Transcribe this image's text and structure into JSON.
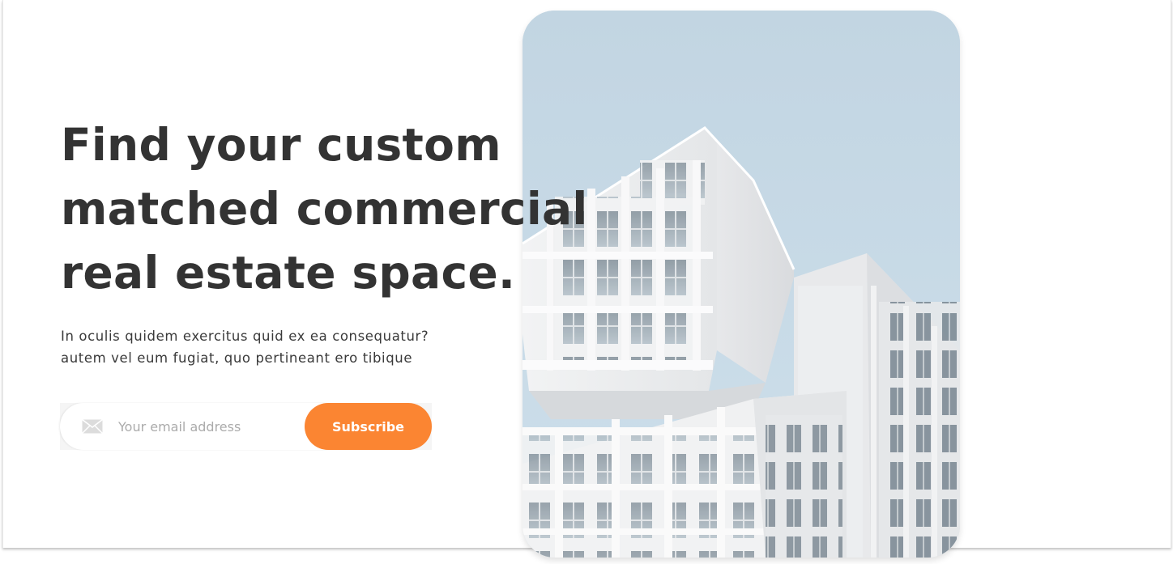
{
  "hero": {
    "headline_lines": [
      "Find your custom",
      "matched commercial",
      "real estate space."
    ],
    "subtext_lines": [
      "In oculis quidem exercitus quid ex ea consequatur?",
      "autem vel eum fugiat, quo pertineant ero tibique"
    ]
  },
  "subscribe": {
    "icon": "mail-icon",
    "email_placeholder": "Your email address",
    "email_value": "",
    "button_label": "Subscribe"
  },
  "image": {
    "subject": "white modern building against blue sky"
  },
  "colors": {
    "accent": "#fb8532",
    "heading": "#333333",
    "body_text": "#3a3a3a",
    "placeholder": "#ababab",
    "sky": "#c3d6e3",
    "background": "#ffffff"
  }
}
